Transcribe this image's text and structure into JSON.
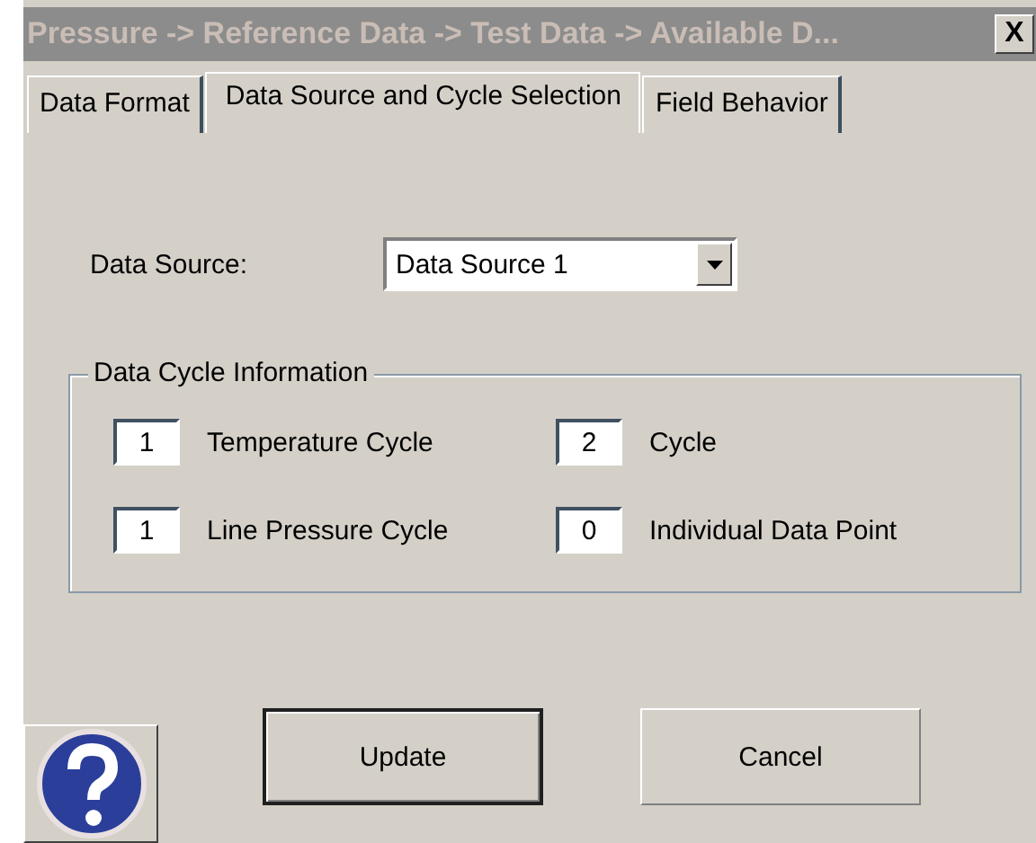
{
  "window": {
    "title": "Pressure -> Reference Data -> Test Data -> Available D..."
  },
  "close_button": {
    "label": "X"
  },
  "tabs": [
    {
      "label": "Data Format",
      "selected": false
    },
    {
      "label": "Data Source and Cycle Selection",
      "selected": true
    },
    {
      "label": "Field Behavior",
      "selected": false
    }
  ],
  "data_source": {
    "label": "Data Source:",
    "value": "Data Source 1"
  },
  "cycle_group": {
    "title": "Data Cycle Information",
    "fields": [
      {
        "value": "1",
        "label": "Temperature Cycle"
      },
      {
        "value": "2",
        "label": "Cycle"
      },
      {
        "value": "1",
        "label": "Line Pressure Cycle"
      },
      {
        "value": "0",
        "label": "Individual Data Point"
      }
    ]
  },
  "buttons": [
    {
      "label": "Update",
      "default": true
    },
    {
      "label": "Cancel",
      "default": false
    }
  ]
}
